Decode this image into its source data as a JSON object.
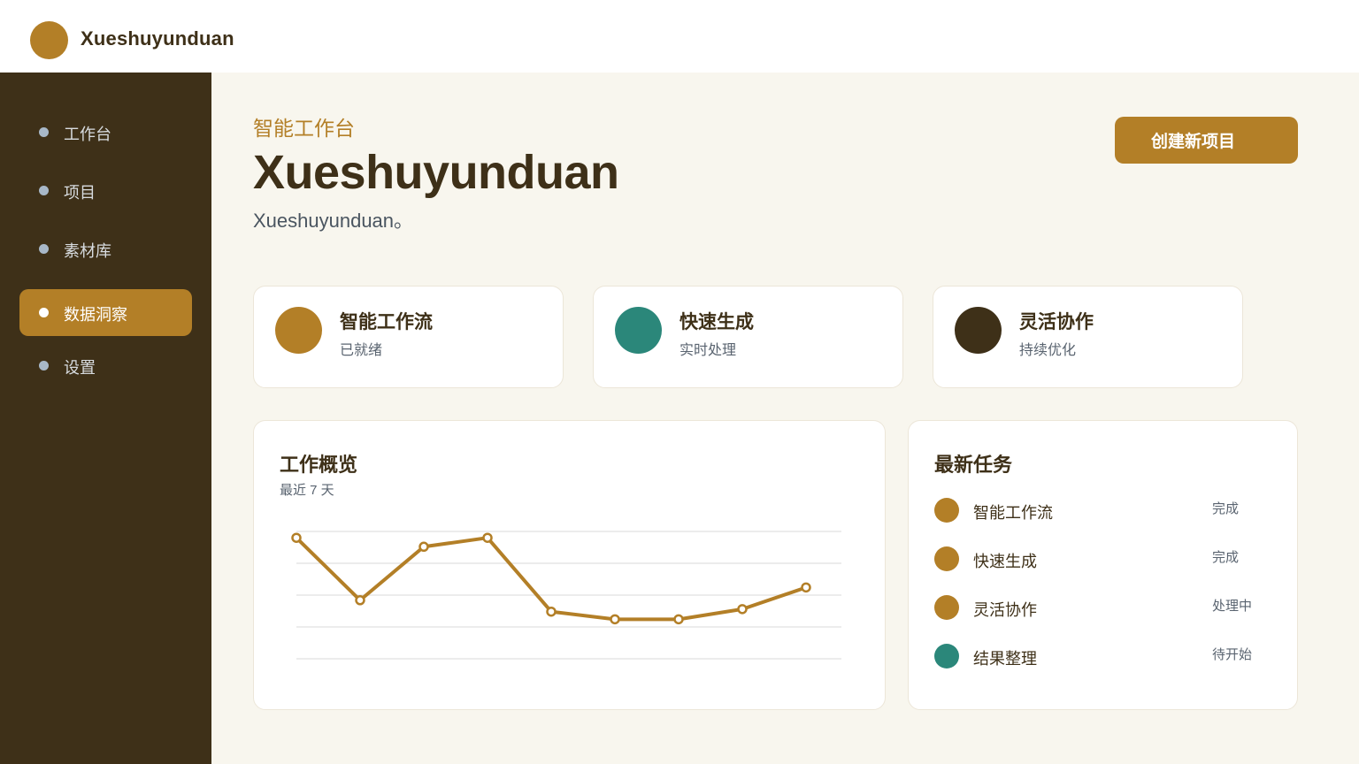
{
  "app": {
    "brand": "Xueshuyunduan"
  },
  "colors": {
    "accent": "#b37f27",
    "teal": "#2b877a",
    "dark": "#3e3018"
  },
  "sidebar": {
    "items": [
      {
        "label": "工作台"
      },
      {
        "label": "项目"
      },
      {
        "label": "素材库"
      },
      {
        "label": "数据洞察",
        "active": true
      },
      {
        "label": "设置"
      }
    ]
  },
  "header": {
    "eyebrow": "智能工作台",
    "title": "Xueshuyunduan",
    "subtitle": "Xueshuyunduan。",
    "create_label": "创建新项目"
  },
  "features": [
    {
      "title": "智能工作流",
      "sub": "已就绪",
      "color": "#b37f27"
    },
    {
      "title": "快速生成",
      "sub": "实时处理",
      "color": "#2b877a"
    },
    {
      "title": "灵活协作",
      "sub": "持续优化",
      "color": "#3e3018"
    }
  ],
  "overview": {
    "title": "工作概览",
    "subtitle": "最近 7 天"
  },
  "chart_data": {
    "type": "line",
    "title": "工作概览",
    "x": [
      1,
      2,
      3,
      4,
      5,
      6,
      7,
      8,
      9
    ],
    "series": [
      {
        "values": [
          95,
          46,
          88,
          95,
          37,
          31,
          31,
          39,
          56
        ]
      }
    ],
    "ylim": [
      0,
      100
    ],
    "grid": true,
    "color": "#b37f27"
  },
  "tasks": {
    "title": "最新任务",
    "items": [
      {
        "name": "智能工作流",
        "status": "完成",
        "color": "#b37f27"
      },
      {
        "name": "快速生成",
        "status": "完成",
        "color": "#b37f27"
      },
      {
        "name": "灵活协作",
        "status": "处理中",
        "color": "#b37f27"
      },
      {
        "name": "结果整理",
        "status": "待开始",
        "color": "#2b877a"
      }
    ]
  }
}
